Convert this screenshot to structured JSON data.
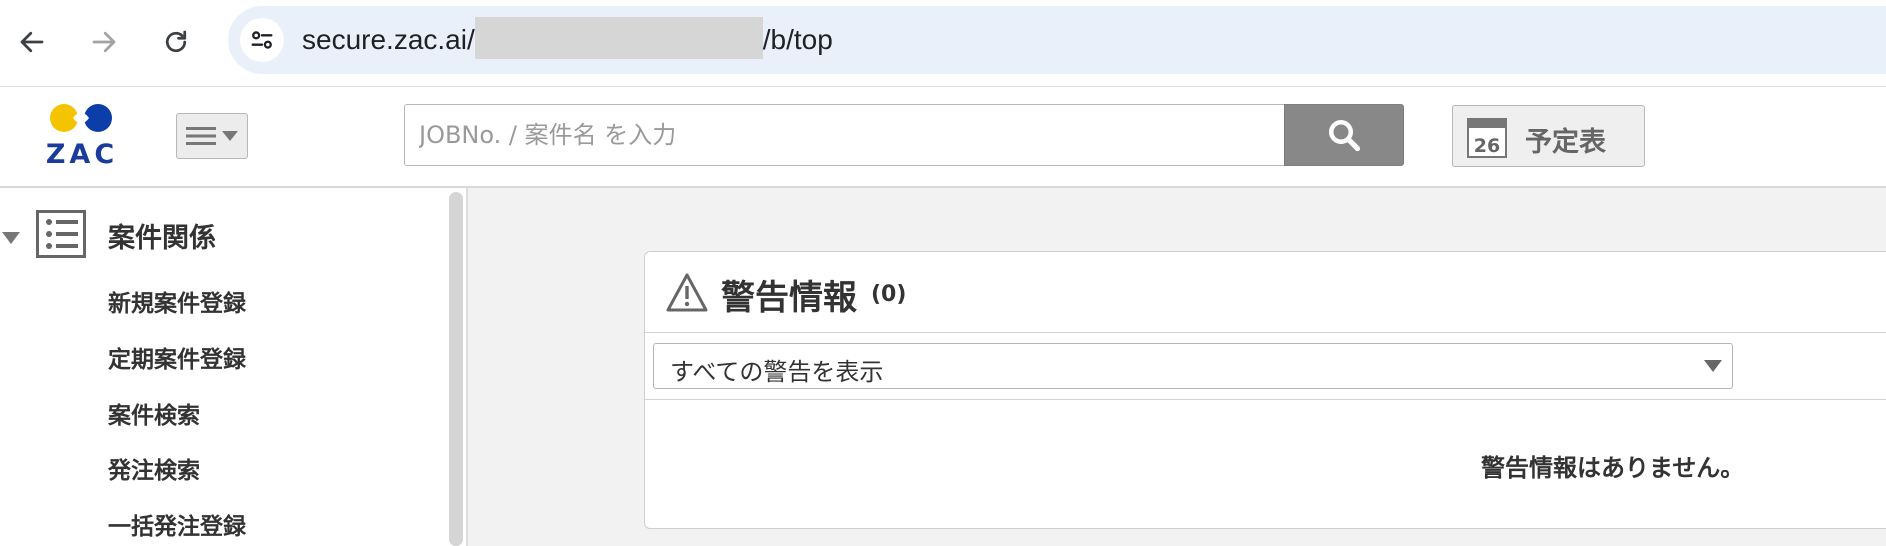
{
  "browser": {
    "url_prefix": "secure.zac.ai/",
    "url_suffix": "/b/top",
    "back_icon": "arrow-left-icon",
    "forward_icon": "arrow-right-icon",
    "reload_icon": "reload-icon",
    "site_info_icon": "tune-icon"
  },
  "header": {
    "logo_text": "ZAC",
    "menu_icon": "hamburger-icon",
    "search_placeholder": "JOBNo. / 案件名 を入力",
    "search_value": "",
    "search_icon": "search-icon",
    "schedule_day": "26",
    "schedule_label": "予定表"
  },
  "sidebar": {
    "section_title": "案件関係",
    "items": [
      {
        "label": "新規案件登録"
      },
      {
        "label": "定期案件登録"
      },
      {
        "label": "案件検索"
      },
      {
        "label": "発注検索"
      },
      {
        "label": "一括発注登録"
      }
    ]
  },
  "panel": {
    "title": "警告情報",
    "count": "(0)",
    "filter_selected": "すべての警告を表示",
    "empty_message": "警告情報はありません。"
  },
  "colors": {
    "logo_yellow": "#f5c400",
    "logo_blue": "#0b3ea8",
    "search_button": "#888888",
    "main_background": "#f2f2f2"
  }
}
